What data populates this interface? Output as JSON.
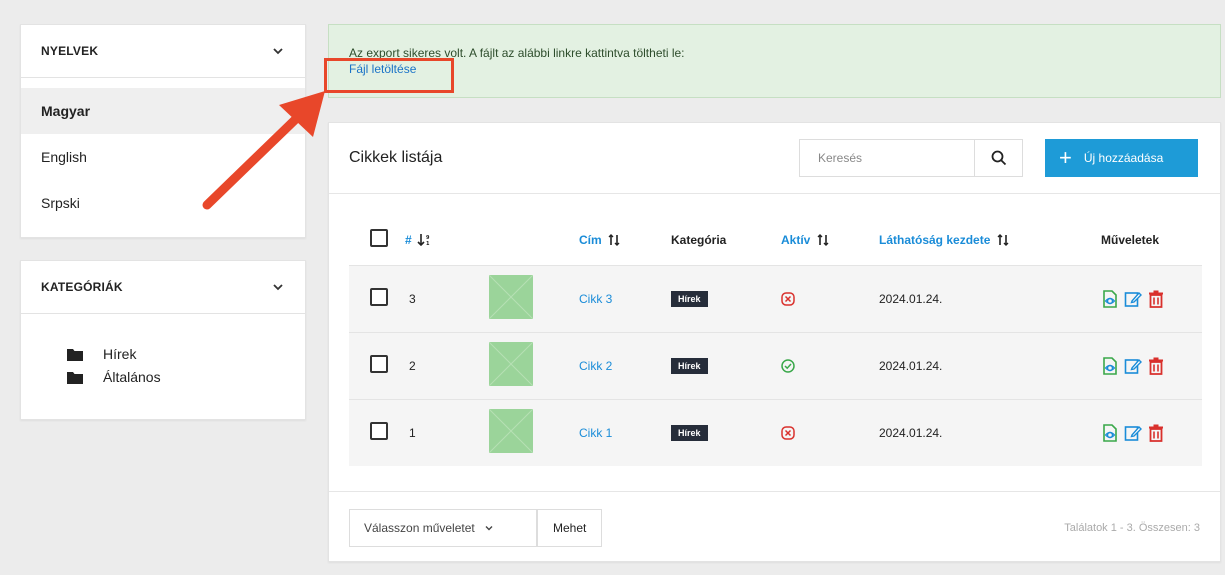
{
  "sidebar": {
    "languages": {
      "title": "NYELVEK",
      "items": [
        {
          "label": "Magyar",
          "active": true
        },
        {
          "label": "English",
          "active": false
        },
        {
          "label": "Srpski",
          "active": false
        }
      ]
    },
    "categories": {
      "title": "KATEGÓRIÁK",
      "items": [
        {
          "label": "Hírek"
        },
        {
          "label": "Általános"
        }
      ]
    }
  },
  "alert": {
    "message": "Az export sikeres volt. A fájlt az alábbi linkre kattintva töltheti le:",
    "link": "Fájl letöltése"
  },
  "main": {
    "title": "Cikkek listája",
    "search_placeholder": "Keresés",
    "add_label": "Új hozzáadása",
    "columns": {
      "id": "#",
      "title": "Cím",
      "category": "Kategória",
      "active": "Aktív",
      "visible_from": "Láthatóság kezdete",
      "actions": "Műveletek"
    },
    "rows": [
      {
        "id": "3",
        "title": "Cikk 3",
        "category": "Hírek",
        "active": false,
        "visible_from": "2024.01.24."
      },
      {
        "id": "2",
        "title": "Cikk 2",
        "category": "Hírek",
        "active": true,
        "visible_from": "2024.01.24."
      },
      {
        "id": "1",
        "title": "Cikk 1",
        "category": "Hírek",
        "active": false,
        "visible_from": "2024.01.24."
      }
    ],
    "bulk_action_placeholder": "Válasszon műveletet",
    "go_label": "Mehet",
    "pagination": "Találatok 1 - 3. Összesen: 3"
  },
  "colors": {
    "accent": "#1e9bd7",
    "link": "#1a8cd8",
    "highlight": "#e8472a",
    "success": "#3aa84a",
    "danger": "#d9302c"
  }
}
